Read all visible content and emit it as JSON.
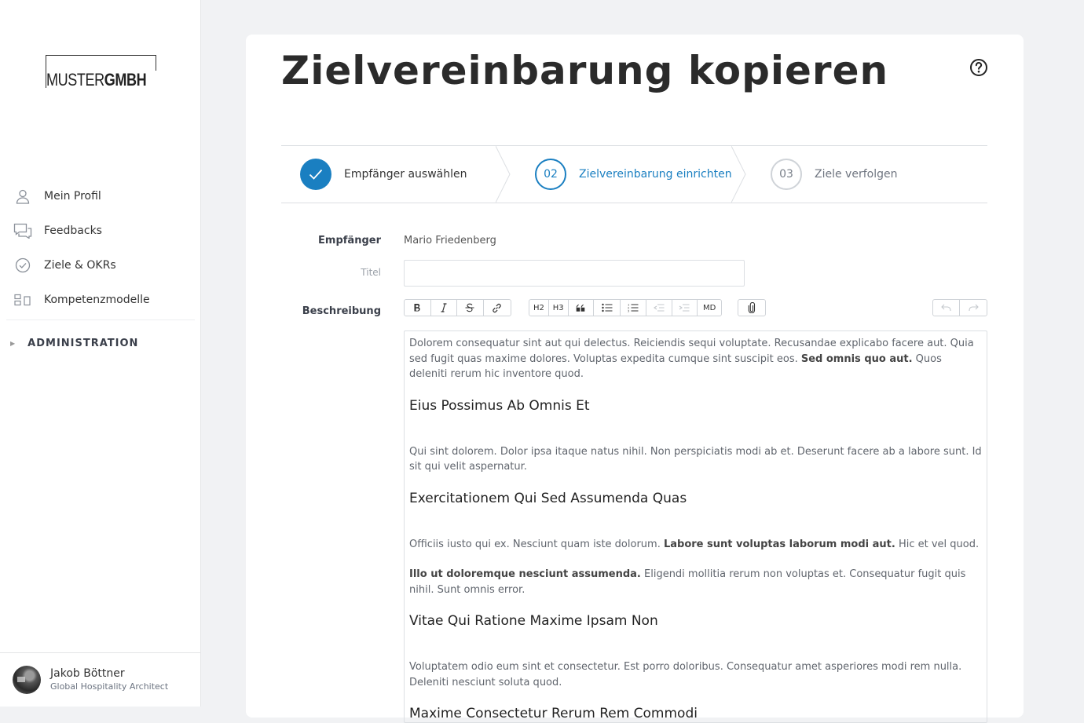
{
  "brand": {
    "logo_light": "MUSTER",
    "logo_bold": "GMBH"
  },
  "sidebar": {
    "items": [
      {
        "label": "Mein Profil",
        "icon": "user-icon"
      },
      {
        "label": "Feedbacks",
        "icon": "feedback-chat-icon"
      },
      {
        "label": "Ziele & OKRs",
        "icon": "check-circle-icon"
      },
      {
        "label": "Kompetenzmodelle",
        "icon": "competence-model-icon"
      }
    ],
    "admin_label": "ADMINISTRATION"
  },
  "user": {
    "name": "Jakob Böttner",
    "role": "Global Hospitality Architect"
  },
  "page": {
    "title": "Zielvereinbarung kopieren"
  },
  "stepper": {
    "steps": [
      {
        "number": "",
        "label": "Empfänger auswählen",
        "state": "done"
      },
      {
        "number": "02",
        "label": "Zielvereinbarung einrichten",
        "state": "active"
      },
      {
        "number": "03",
        "label": "Ziele verfolgen",
        "state": "todo"
      }
    ]
  },
  "form": {
    "recipient_label": "Empfänger",
    "recipient_value": "Mario Friedenberg",
    "title_label": "Titel",
    "title_value": "",
    "description_label": "Beschreibung"
  },
  "toolbar": {
    "h2": "H2",
    "h3": "H3",
    "md": "MD"
  },
  "editor": {
    "p1a": "Dolorem consequatur sint aut qui delectus. Reiciendis sequi voluptate. Recusandae explicabo facere aut. Quia sed fugit quas maxime dolores. Voluptas expedita cumque sint suscipit eos. ",
    "p1b": "Sed omnis quo aut.",
    "p1c": " Quos deleniti rerum hic inventore quod.",
    "h1": "Eius Possimus Ab Omnis Et",
    "p2": "Qui sint dolorem. Dolor ipsa itaque natus nihil. Non perspiciatis modi ab et. Deserunt facere ab a labore sunt. Id sit qui velit aspernatur.",
    "h2": "Exercitationem Qui Sed Assumenda Quas",
    "p3a": "Officiis iusto qui ex. Nesciunt quam iste dolorum. ",
    "p3b": "Labore sunt voluptas laborum modi aut.",
    "p3c": " Hic et vel quod.",
    "p4a": "Illo ut doloremque nesciunt assumenda.",
    "p4b": " Eligendi mollitia rerum non voluptas et. Consequatur fugit quis nihil. Sunt omnis error.",
    "h3": "Vitae Qui Ratione Maxime Ipsam Non",
    "p5": "Voluptatem odio eum sint et consectetur. Est porro doloribus. Consequatur amet asperiores modi rem nulla. Deleniti nesciunt soluta quod.",
    "h4": "Maxime Consectetur Rerum Rem Commodi"
  },
  "colors": {
    "accent": "#1a7fc1",
    "background": "#f1f2f4"
  }
}
